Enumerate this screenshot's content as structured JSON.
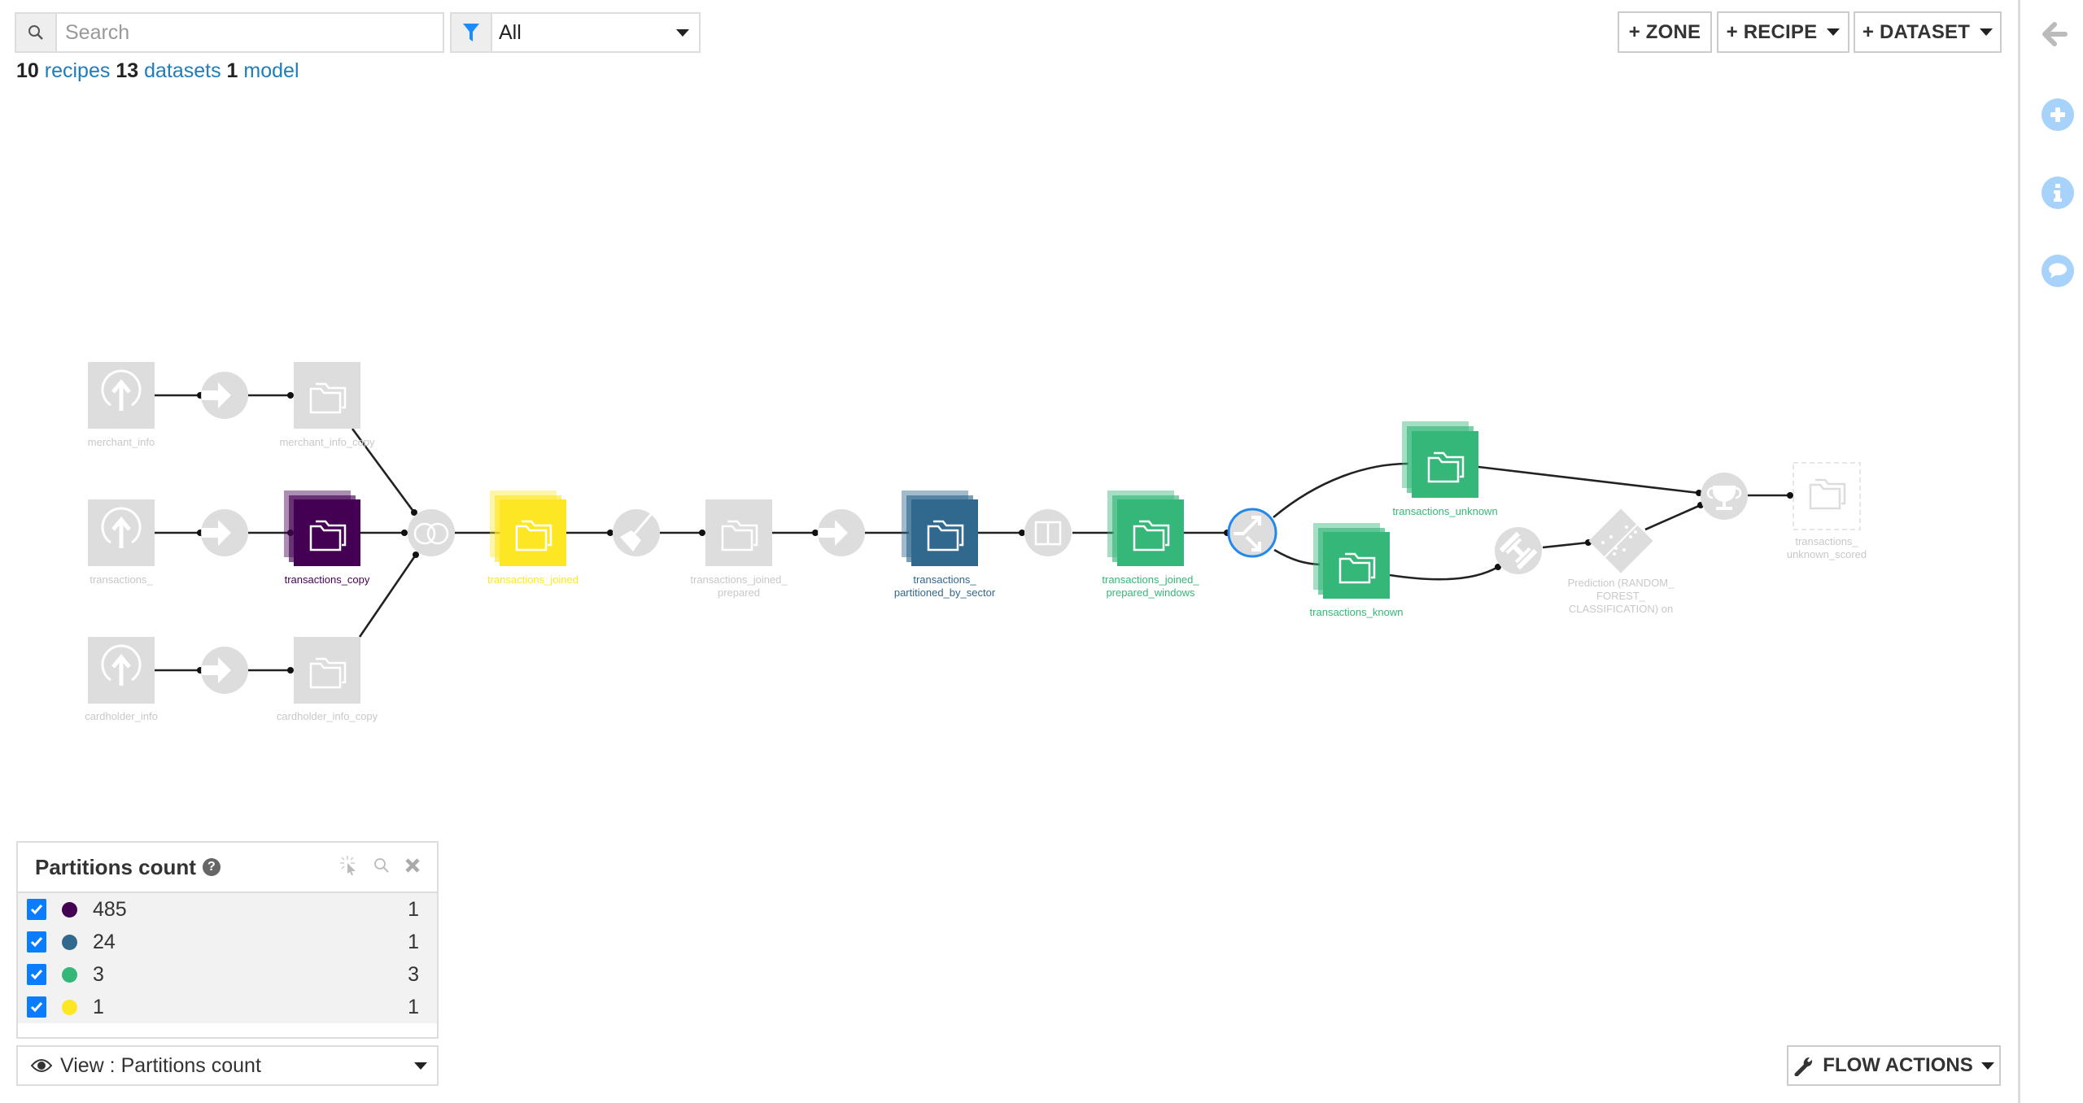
{
  "toolbar": {
    "search_placeholder": "Search",
    "search_value": "",
    "filter_selected": "All",
    "zone_button": "+ ZONE",
    "recipe_button": "+ RECIPE",
    "dataset_button": "+ DATASET"
  },
  "stats": {
    "recipes_count": "10",
    "recipes_label": "recipes",
    "datasets_count": "13",
    "datasets_label": "datasets",
    "models_count": "1",
    "models_label": "model"
  },
  "sidebar": {
    "icons": [
      "arrow-left-icon",
      "plus-circle-icon",
      "info-circle-icon",
      "comment-icon"
    ]
  },
  "colors": {
    "partitions_485": "#440154",
    "partitions_24": "#31688e",
    "partitions_3": "#35b779",
    "partitions_1": "#fde725",
    "inactive_node": "#dddddd",
    "selected_ring": "#2288ee",
    "link": "#1f7dba"
  },
  "flow": {
    "nodes": {
      "merchant_info": "merchant_info",
      "merchant_info_copy": "merchant_info_copy",
      "transactions_": "transactions_",
      "transactions_copy": "transactions_copy",
      "cardholder_info": "cardholder_info",
      "cardholder_info_copy": "cardholder_info_copy",
      "transactions_joined": "transactions_joined",
      "transactions_joined_prepared_l1": "transactions_joined_",
      "transactions_joined_prepared_l2": "prepared",
      "partitioned_l1": "transactions_",
      "partitioned_l2": "partitioned_by_sector",
      "windows_l1": "transactions_joined_",
      "windows_l2": "prepared_windows",
      "transactions_unknown": "transactions_unknown",
      "transactions_known": "transactions_known",
      "model_l1": "Prediction (RANDOM_",
      "model_l2": "FOREST_",
      "model_l3": "CLASSIFICATION) on",
      "scored_l1": "transactions_",
      "scored_l2": "unknown_scored"
    }
  },
  "legend": {
    "title": "Partitions count",
    "rows": [
      {
        "value": "485",
        "count": "1",
        "checked": true
      },
      {
        "value": "24",
        "count": "1",
        "checked": true
      },
      {
        "value": "3",
        "count": "3",
        "checked": true
      },
      {
        "value": "1",
        "count": "1",
        "checked": true
      }
    ],
    "view_label": "View : Partitions count"
  },
  "footer": {
    "flow_actions": "FLOW ACTIONS"
  }
}
